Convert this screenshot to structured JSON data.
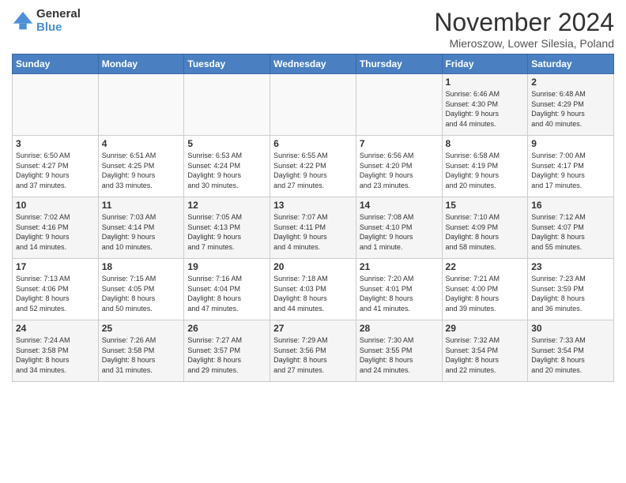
{
  "header": {
    "logo_line1": "General",
    "logo_line2": "Blue",
    "month": "November 2024",
    "location": "Mieroszow, Lower Silesia, Poland"
  },
  "days_of_week": [
    "Sunday",
    "Monday",
    "Tuesday",
    "Wednesday",
    "Thursday",
    "Friday",
    "Saturday"
  ],
  "weeks": [
    [
      {
        "day": "",
        "info": ""
      },
      {
        "day": "",
        "info": ""
      },
      {
        "day": "",
        "info": ""
      },
      {
        "day": "",
        "info": ""
      },
      {
        "day": "",
        "info": ""
      },
      {
        "day": "1",
        "info": "Sunrise: 6:46 AM\nSunset: 4:30 PM\nDaylight: 9 hours\nand 44 minutes."
      },
      {
        "day": "2",
        "info": "Sunrise: 6:48 AM\nSunset: 4:29 PM\nDaylight: 9 hours\nand 40 minutes."
      }
    ],
    [
      {
        "day": "3",
        "info": "Sunrise: 6:50 AM\nSunset: 4:27 PM\nDaylight: 9 hours\nand 37 minutes."
      },
      {
        "day": "4",
        "info": "Sunrise: 6:51 AM\nSunset: 4:25 PM\nDaylight: 9 hours\nand 33 minutes."
      },
      {
        "day": "5",
        "info": "Sunrise: 6:53 AM\nSunset: 4:24 PM\nDaylight: 9 hours\nand 30 minutes."
      },
      {
        "day": "6",
        "info": "Sunrise: 6:55 AM\nSunset: 4:22 PM\nDaylight: 9 hours\nand 27 minutes."
      },
      {
        "day": "7",
        "info": "Sunrise: 6:56 AM\nSunset: 4:20 PM\nDaylight: 9 hours\nand 23 minutes."
      },
      {
        "day": "8",
        "info": "Sunrise: 6:58 AM\nSunset: 4:19 PM\nDaylight: 9 hours\nand 20 minutes."
      },
      {
        "day": "9",
        "info": "Sunrise: 7:00 AM\nSunset: 4:17 PM\nDaylight: 9 hours\nand 17 minutes."
      }
    ],
    [
      {
        "day": "10",
        "info": "Sunrise: 7:02 AM\nSunset: 4:16 PM\nDaylight: 9 hours\nand 14 minutes."
      },
      {
        "day": "11",
        "info": "Sunrise: 7:03 AM\nSunset: 4:14 PM\nDaylight: 9 hours\nand 10 minutes."
      },
      {
        "day": "12",
        "info": "Sunrise: 7:05 AM\nSunset: 4:13 PM\nDaylight: 9 hours\nand 7 minutes."
      },
      {
        "day": "13",
        "info": "Sunrise: 7:07 AM\nSunset: 4:11 PM\nDaylight: 9 hours\nand 4 minutes."
      },
      {
        "day": "14",
        "info": "Sunrise: 7:08 AM\nSunset: 4:10 PM\nDaylight: 9 hours\nand 1 minute."
      },
      {
        "day": "15",
        "info": "Sunrise: 7:10 AM\nSunset: 4:09 PM\nDaylight: 8 hours\nand 58 minutes."
      },
      {
        "day": "16",
        "info": "Sunrise: 7:12 AM\nSunset: 4:07 PM\nDaylight: 8 hours\nand 55 minutes."
      }
    ],
    [
      {
        "day": "17",
        "info": "Sunrise: 7:13 AM\nSunset: 4:06 PM\nDaylight: 8 hours\nand 52 minutes."
      },
      {
        "day": "18",
        "info": "Sunrise: 7:15 AM\nSunset: 4:05 PM\nDaylight: 8 hours\nand 50 minutes."
      },
      {
        "day": "19",
        "info": "Sunrise: 7:16 AM\nSunset: 4:04 PM\nDaylight: 8 hours\nand 47 minutes."
      },
      {
        "day": "20",
        "info": "Sunrise: 7:18 AM\nSunset: 4:03 PM\nDaylight: 8 hours\nand 44 minutes."
      },
      {
        "day": "21",
        "info": "Sunrise: 7:20 AM\nSunset: 4:01 PM\nDaylight: 8 hours\nand 41 minutes."
      },
      {
        "day": "22",
        "info": "Sunrise: 7:21 AM\nSunset: 4:00 PM\nDaylight: 8 hours\nand 39 minutes."
      },
      {
        "day": "23",
        "info": "Sunrise: 7:23 AM\nSunset: 3:59 PM\nDaylight: 8 hours\nand 36 minutes."
      }
    ],
    [
      {
        "day": "24",
        "info": "Sunrise: 7:24 AM\nSunset: 3:58 PM\nDaylight: 8 hours\nand 34 minutes."
      },
      {
        "day": "25",
        "info": "Sunrise: 7:26 AM\nSunset: 3:58 PM\nDaylight: 8 hours\nand 31 minutes."
      },
      {
        "day": "26",
        "info": "Sunrise: 7:27 AM\nSunset: 3:57 PM\nDaylight: 8 hours\nand 29 minutes."
      },
      {
        "day": "27",
        "info": "Sunrise: 7:29 AM\nSunset: 3:56 PM\nDaylight: 8 hours\nand 27 minutes."
      },
      {
        "day": "28",
        "info": "Sunrise: 7:30 AM\nSunset: 3:55 PM\nDaylight: 8 hours\nand 24 minutes."
      },
      {
        "day": "29",
        "info": "Sunrise: 7:32 AM\nSunset: 3:54 PM\nDaylight: 8 hours\nand 22 minutes."
      },
      {
        "day": "30",
        "info": "Sunrise: 7:33 AM\nSunset: 3:54 PM\nDaylight: 8 hours\nand 20 minutes."
      }
    ]
  ]
}
